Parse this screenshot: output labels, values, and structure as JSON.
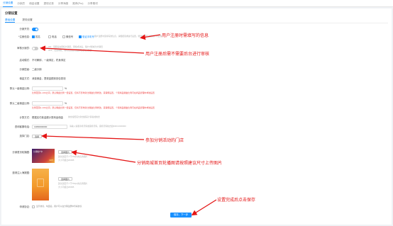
{
  "topnav": {
    "tabs": [
      "分销设置",
      "分销员",
      "佣金设置",
      "提现记录",
      "分享海报",
      "推荐(Pro)",
      "分享素材"
    ]
  },
  "page": {
    "title": "分销设置"
  },
  "subtabs": [
    "基础设置",
    "提现设置"
  ],
  "form": {
    "open_label": "分销开关:",
    "reg_info_label": "*注册信息:",
    "reg_options": [
      "姓名",
      "电话",
      "微信号"
    ],
    "reg_info_extra": "验证手机号",
    "reg_info_hint": "用户注册时需填写的信息，请根据需求进行设置，修改后对已注册用户不生效",
    "audit_label": "审核分销员:",
    "audit_hint_on": "ON：需要后台审核分销员，审核成功后，用户才能成为分销员",
    "audit_hint_off": "OFF：无需审核，填写信息提交后即可成为分销员",
    "mode_label": "启动模式:",
    "mode_value": "不可解绑，一级绑定，终身绑定",
    "level_label": "分销层级:",
    "level_value": "二级分销",
    "rebate_label": "佣金方式:",
    "rebate_value": "消费佣金，提现金额到钱包零钱",
    "first_label": "默认一级佣金比例:",
    "first_unit": "%",
    "first_warn": "比例范围1~100之间，默认佣金比例一经设置，仅将不影响对比佣金比例修改，需谨慎设置，个别商品佣金比例可在商品管理中单独设置",
    "second_label": "默认二级佣金比例:",
    "second_unit": "%",
    "second_warn": "比例范围1~100之间，默认佣金比例一经设置，仅将不影响对比佣金比例修改，需谨慎设置，个别商品佣金比例可在商品管理中单独设置",
    "calc_label": "计算方式:",
    "calc_value": "根据实付款金额计算商品佣金",
    "calc_hint": "佣金按照实付款金额来计算提成佣金",
    "phone_label": "咨询客服电话:",
    "phone_value": "13800000000",
    "phone_hint": "请输入客服手机号码或座机号码，座机号码格式如0000-0000000",
    "stores_label": "选择门店:",
    "stores_btn": "选择",
    "banner_label": "分销首页轮播图:",
    "banner_tags": [
      "分销推广中",
      "HOT"
    ],
    "banner_btn": "选择图片",
    "banner_hint_1": "建议宽度不少于750px的高清图片",
    "banner_hint_2": "大小不超过200KB",
    "poster_label": "邀请注入海报图:",
    "poster_btn": "选择图片",
    "poster_hint_1": "建议宽度不少于750px的高清图片",
    "poster_hint_2": "大小不超过200KB",
    "agree_label": "申请协议:",
    "agree_text": "显示协议，勾选后，用户可以在分销注册中查看协议",
    "save_label": "保存，下一步"
  },
  "annotations": {
    "a1": "用户注册时需填写的信息",
    "a2": "用户注册后需不需要后台进行审核",
    "a3": "参加分销活动的门店",
    "a4": "分销商城首页轮播图请按照建议尺寸上传图片",
    "a5": "设置完成后点击保存"
  },
  "colors": {
    "accent": "#1890ff",
    "annotation": "#e41414",
    "poster_orange": "#f39a2a"
  }
}
